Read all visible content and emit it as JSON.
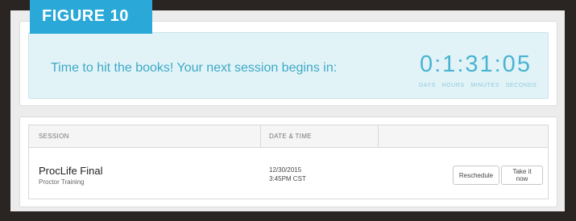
{
  "figure_label": "FIGURE 10",
  "countdown": {
    "message": "Time to hit the books! Your next session begins in:",
    "timer": "0:1:31:05",
    "labels": [
      "DAYS",
      "HOURS",
      "MINUTES",
      "SECONDS"
    ]
  },
  "sessions": {
    "headers": [
      "SESSION",
      "DATE & TIME",
      ""
    ],
    "rows": [
      {
        "name": "ProcLife Final",
        "subtitle": "Proctor Training",
        "date": "12/30/2015",
        "time": "3:45PM CST",
        "reschedule_label": "Reschedule",
        "take_label": "Take it now"
      }
    ]
  },
  "colors": {
    "accent": "#2aa9d8",
    "timer": "#4ab3d3",
    "panel_bg": "#e2f3f7",
    "frame": "#2a2522"
  }
}
